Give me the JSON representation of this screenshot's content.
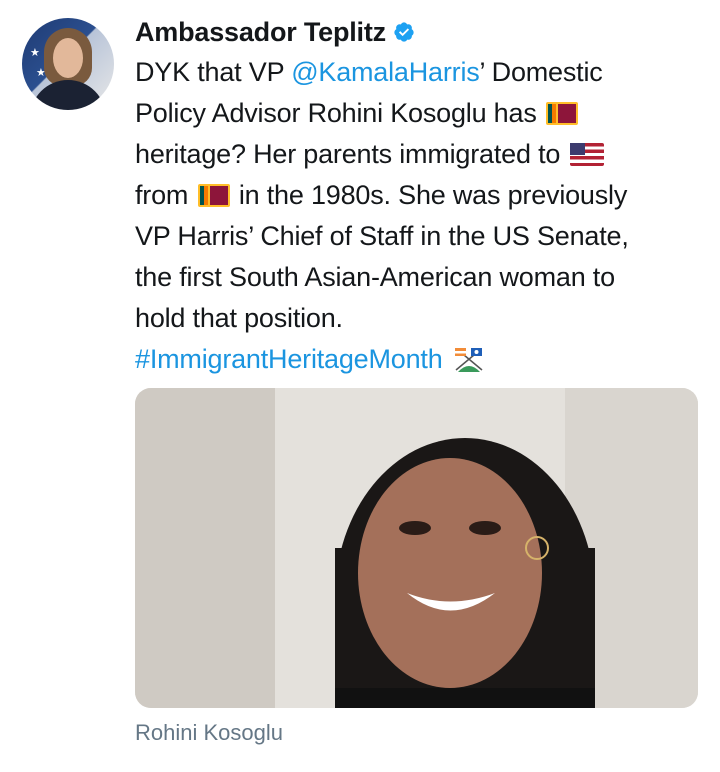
{
  "author": {
    "name": "Ambassador Teplitz",
    "verified": true
  },
  "tweet": {
    "line1_prefix": "DYK that VP ",
    "mention": "@KamalaHarris",
    "line1_suffix": "’ Domestic",
    "line2": "Policy Advisor Rohini Kosoglu has",
    "line3": "heritage? Her parents immigrated to",
    "line4_prefix": "from",
    "line4_suffix": " in the 1980s. She was previously",
    "line5": "VP Harris’ Chief of Staff in the US Senate,",
    "line6": "the first South Asian-American woman to",
    "line7": "hold that position.",
    "hashtag": "#ImmigrantHeritageMonth"
  },
  "media": {
    "caption": "Rohini Kosoglu"
  },
  "colors": {
    "link": "#1b95e0",
    "caption": "#657786",
    "verified": "#1da1f2"
  }
}
